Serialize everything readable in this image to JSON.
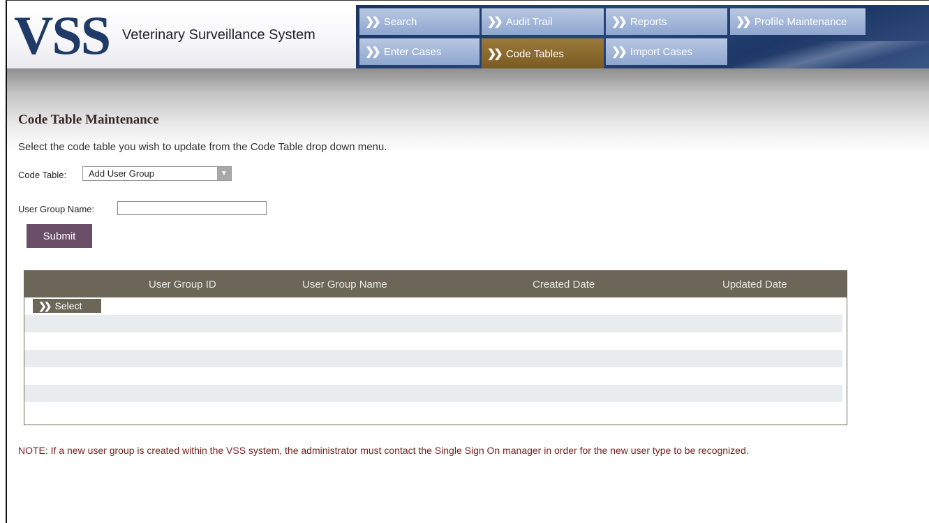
{
  "header": {
    "logo": "VSS",
    "app_name": "Veterinary Surveillance System",
    "nav": [
      {
        "label": "Search"
      },
      {
        "label": "Audit Trail"
      },
      {
        "label": "Reports"
      },
      {
        "label": "Profile Maintenance"
      },
      {
        "label": "Enter Cases"
      },
      {
        "label": "Code Tables",
        "active": true
      },
      {
        "label": "Import Cases"
      }
    ],
    "colors": {
      "navy": "#1f3a66",
      "gold": "#7a5a22",
      "nav_button": "#8ea6cf"
    }
  },
  "page": {
    "title": "Code Table Maintenance",
    "instructions": "Select the code table you wish to update from the Code Table drop down menu."
  },
  "form": {
    "code_table_label": "Code Table:",
    "code_table_value": "Add User Group",
    "user_group_label": "User Group Name:",
    "user_group_value": "",
    "submit_label": "Submit"
  },
  "grid": {
    "columns": [
      "User Group ID",
      "User Group Name",
      "Created Date",
      "Updated Date"
    ],
    "select_label": "Select",
    "rows": []
  },
  "note": "NOTE:  If a new user group is created within the VSS system, the administrator must contact the Single Sign On manager in order for the new user type to be recognized."
}
